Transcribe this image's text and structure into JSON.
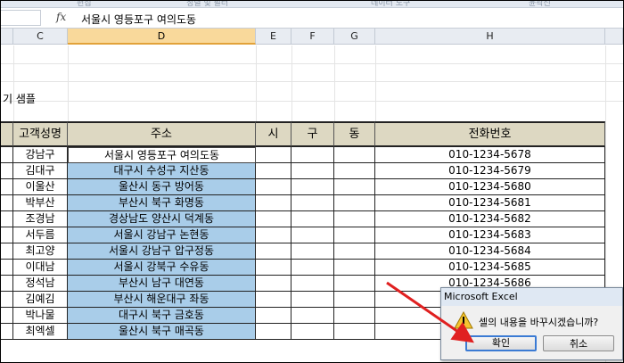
{
  "ribbon": {
    "groups": [
      "편집",
      "정렬 및 필터",
      "데이터 도구",
      "윤곽선"
    ]
  },
  "formula_bar": {
    "fx_label": "fx",
    "value": "서울시 영등포구 여의도동"
  },
  "columns": [
    "C",
    "D",
    "E",
    "F",
    "G",
    "H"
  ],
  "sheet": {
    "sample_label": "기 샘플",
    "headers": {
      "name": "고객성명",
      "address": "주소",
      "si": "시",
      "gu": "구",
      "dong": "동",
      "phone": "전화번호"
    },
    "rows": [
      {
        "name": "강남구",
        "address": "서울시 영등포구 여의도동",
        "phone": "010-1234-5678"
      },
      {
        "name": "김대구",
        "address": "대구시 수성구 지산동",
        "phone": "010-1234-5679"
      },
      {
        "name": "이울산",
        "address": "울산시 동구 방어동",
        "phone": "010-1234-5680"
      },
      {
        "name": "박부산",
        "address": "부산시 북구 화명동",
        "phone": "010-1234-5681"
      },
      {
        "name": "조경남",
        "address": "경상남도 양산시 덕계동",
        "phone": "010-1234-5682"
      },
      {
        "name": "서두름",
        "address": "서울시 강남구 논현동",
        "phone": "010-1234-5683"
      },
      {
        "name": "최고양",
        "address": "서울시 강남구 압구정동",
        "phone": "010-1234-5684"
      },
      {
        "name": "이대남",
        "address": "서울시 강북구 수유동",
        "phone": "010-1234-5685"
      },
      {
        "name": "정석남",
        "address": "부산시 남구 대연동",
        "phone": "010-1234-5686"
      },
      {
        "name": "김예김",
        "address": "부산시 해운대구 좌동",
        "phone": ""
      },
      {
        "name": "박나물",
        "address": "대구시 북구 금호동",
        "phone": ""
      },
      {
        "name": "최엑셀",
        "address": "울산시 북구 매곡동",
        "phone": ""
      }
    ]
  },
  "dialog": {
    "title": "Microsoft Excel",
    "message": "셀의 내용을 바꾸시겠습니까?",
    "ok_label": "확인",
    "cancel_label": "취소"
  },
  "colors": {
    "selected_range": "#a9cde9",
    "header_fill": "#ddd8c2",
    "annotation_arrow": "#e02020"
  }
}
